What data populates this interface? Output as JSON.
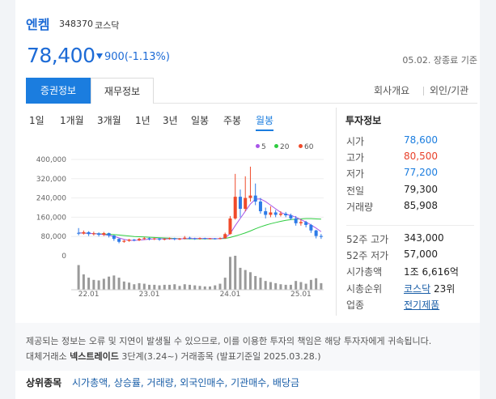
{
  "header": {
    "name": "엔켐",
    "code": "348370",
    "market": "코스닥",
    "price": "78,400",
    "change": "900(-1.13%)",
    "asof": "05.02. 장종료 기준"
  },
  "tabs": {
    "left": [
      "증권정보",
      "재무정보"
    ],
    "right": [
      "회사개요",
      "외인/기관"
    ]
  },
  "periods": [
    "1일",
    "1개월",
    "3개월",
    "1년",
    "3년",
    "일봉",
    "주봉",
    "월봉"
  ],
  "active_period": "월봉",
  "legend": [
    {
      "label": "5",
      "color": "#a855e8"
    },
    {
      "label": "20",
      "color": "#2ecc40"
    },
    {
      "label": "60",
      "color": "#f04a2a"
    }
  ],
  "chart_data": {
    "type": "candlestick",
    "y_ticks": [
      "400,000",
      "320,000",
      "240,000",
      "160,000",
      "80,000",
      "0"
    ],
    "x_ticks": [
      "22.01",
      "23.01",
      "24.01",
      "25.01"
    ],
    "ylim": [
      0,
      400000
    ],
    "candles": [
      {
        "o": 95000,
        "c": 92000,
        "h": 115000,
        "l": 85000,
        "v": 45000
      },
      {
        "o": 92000,
        "c": 98000,
        "h": 105000,
        "l": 88000,
        "v": 28000
      },
      {
        "o": 98000,
        "c": 90000,
        "h": 102000,
        "l": 82000,
        "v": 22000
      },
      {
        "o": 90000,
        "c": 93000,
        "h": 100000,
        "l": 84000,
        "v": 18000
      },
      {
        "o": 93000,
        "c": 87000,
        "h": 97000,
        "l": 80000,
        "v": 17000
      },
      {
        "o": 87000,
        "c": 94000,
        "h": 99000,
        "l": 82000,
        "v": 20000
      },
      {
        "o": 94000,
        "c": 84000,
        "h": 96000,
        "l": 76000,
        "v": 24000
      },
      {
        "o": 84000,
        "c": 70000,
        "h": 86000,
        "l": 62000,
        "v": 26000
      },
      {
        "o": 70000,
        "c": 58000,
        "h": 72000,
        "l": 52000,
        "v": 22000
      },
      {
        "o": 58000,
        "c": 62000,
        "h": 66000,
        "l": 54000,
        "v": 15000
      },
      {
        "o": 62000,
        "c": 67000,
        "h": 70000,
        "l": 58000,
        "v": 13000
      },
      {
        "o": 67000,
        "c": 64000,
        "h": 70000,
        "l": 60000,
        "v": 10000
      },
      {
        "o": 64000,
        "c": 70000,
        "h": 74000,
        "l": 61000,
        "v": 12000
      },
      {
        "o": 70000,
        "c": 73000,
        "h": 78000,
        "l": 66000,
        "v": 11000
      },
      {
        "o": 73000,
        "c": 69000,
        "h": 76000,
        "l": 64000,
        "v": 9000
      },
      {
        "o": 69000,
        "c": 72000,
        "h": 75000,
        "l": 65000,
        "v": 9000
      },
      {
        "o": 72000,
        "c": 67000,
        "h": 74000,
        "l": 62000,
        "v": 8000
      },
      {
        "o": 67000,
        "c": 70000,
        "h": 72000,
        "l": 64000,
        "v": 9000
      },
      {
        "o": 70000,
        "c": 73000,
        "h": 76000,
        "l": 67000,
        "v": 9000
      },
      {
        "o": 73000,
        "c": 69000,
        "h": 75000,
        "l": 64000,
        "v": 10000
      },
      {
        "o": 69000,
        "c": 71000,
        "h": 74000,
        "l": 65000,
        "v": 7000
      },
      {
        "o": 71000,
        "c": 75000,
        "h": 82000,
        "l": 68000,
        "v": 10000
      },
      {
        "o": 75000,
        "c": 72000,
        "h": 79000,
        "l": 68000,
        "v": 9000
      },
      {
        "o": 72000,
        "c": 70000,
        "h": 75000,
        "l": 66000,
        "v": 8000
      },
      {
        "o": 70000,
        "c": 73000,
        "h": 76000,
        "l": 67000,
        "v": 7000
      },
      {
        "o": 73000,
        "c": 71000,
        "h": 75000,
        "l": 67000,
        "v": 6000
      },
      {
        "o": 71000,
        "c": 72000,
        "h": 74000,
        "l": 68000,
        "v": 6000
      },
      {
        "o": 72000,
        "c": 70000,
        "h": 74000,
        "l": 67000,
        "v": 8000
      },
      {
        "o": 70000,
        "c": 73000,
        "h": 76000,
        "l": 68000,
        "v": 11000
      },
      {
        "o": 73000,
        "c": 90000,
        "h": 96000,
        "l": 70000,
        "v": 22000
      },
      {
        "o": 90000,
        "c": 155000,
        "h": 165000,
        "l": 88000,
        "v": 60000
      },
      {
        "o": 155000,
        "c": 245000,
        "h": 340000,
        "l": 150000,
        "v": 62000
      },
      {
        "o": 245000,
        "c": 195000,
        "h": 275000,
        "l": 160000,
        "v": 40000
      },
      {
        "o": 195000,
        "c": 240000,
        "h": 330000,
        "l": 185000,
        "v": 36000
      },
      {
        "o": 240000,
        "c": 250000,
        "h": 370000,
        "l": 225000,
        "v": 32000
      },
      {
        "o": 250000,
        "c": 225000,
        "h": 300000,
        "l": 210000,
        "v": 25000
      },
      {
        "o": 225000,
        "c": 185000,
        "h": 240000,
        "l": 175000,
        "v": 22000
      },
      {
        "o": 185000,
        "c": 170000,
        "h": 200000,
        "l": 155000,
        "v": 16000
      },
      {
        "o": 170000,
        "c": 180000,
        "h": 205000,
        "l": 160000,
        "v": 14000
      },
      {
        "o": 180000,
        "c": 170000,
        "h": 190000,
        "l": 160000,
        "v": 12000
      },
      {
        "o": 170000,
        "c": 175000,
        "h": 185000,
        "l": 163000,
        "v": 10000
      },
      {
        "o": 175000,
        "c": 168000,
        "h": 182000,
        "l": 160000,
        "v": 9000
      },
      {
        "o": 168000,
        "c": 155000,
        "h": 175000,
        "l": 148000,
        "v": 9000
      },
      {
        "o": 155000,
        "c": 135000,
        "h": 165000,
        "l": 125000,
        "v": 16000
      },
      {
        "o": 135000,
        "c": 140000,
        "h": 150000,
        "l": 125000,
        "v": 14000
      },
      {
        "o": 140000,
        "c": 128000,
        "h": 145000,
        "l": 118000,
        "v": 11000
      },
      {
        "o": 128000,
        "c": 105000,
        "h": 132000,
        "l": 95000,
        "v": 18000
      },
      {
        "o": 105000,
        "c": 82000,
        "h": 108000,
        "l": 72000,
        "v": 21000
      },
      {
        "o": 82000,
        "c": 78400,
        "h": 90000,
        "l": 70000,
        "v": 12000
      }
    ],
    "ma5": [
      95000,
      94000,
      93000,
      92000,
      90000,
      88000,
      85000,
      81000,
      74000,
      68000,
      64000,
      64000,
      65000,
      67000,
      69000,
      70000,
      70000,
      70000,
      70000,
      70000,
      70000,
      71000,
      72000,
      72000,
      72000,
      72000,
      72000,
      71000,
      71000,
      75000,
      92000,
      125000,
      155000,
      185000,
      215000,
      235000,
      236000,
      225000,
      210000,
      195000,
      180000,
      172000,
      168000,
      160000,
      150000,
      140000,
      128000,
      115000,
      100000
    ],
    "ma20": [
      95000,
      94000,
      93000,
      92000,
      91000,
      90000,
      89000,
      88000,
      86000,
      84000,
      82000,
      80000,
      79000,
      78000,
      77000,
      76000,
      75000,
      74000,
      73000,
      72000,
      71000,
      70000,
      70000,
      70000,
      70000,
      70000,
      70000,
      70000,
      71000,
      72000,
      76000,
      82000,
      88000,
      95000,
      103000,
      112000,
      120000,
      127000,
      133000,
      138000,
      143000,
      147000,
      150000,
      152000,
      153000,
      154000,
      154000,
      153000,
      152000
    ]
  },
  "info": {
    "title": "투자정보",
    "rows1": [
      {
        "label": "시가",
        "value": "78,600",
        "tone": "dn"
      },
      {
        "label": "고가",
        "value": "80,500",
        "tone": "up"
      },
      {
        "label": "저가",
        "value": "77,200",
        "tone": "dn"
      },
      {
        "label": "전일",
        "value": "79,300",
        "tone": ""
      },
      {
        "label": "거래량",
        "value": "85,908",
        "tone": ""
      }
    ],
    "rows2": [
      {
        "label": "52주 고가",
        "value": "343,000"
      },
      {
        "label": "52주 저가",
        "value": "57,000"
      },
      {
        "label": "시가총액",
        "value": "1조 6,616억"
      }
    ],
    "rank_label": "시총순위",
    "rank_market": "코스닥",
    "rank_num": "23위",
    "sector_label": "업종",
    "sector_value": "전기제품"
  },
  "notice": {
    "line1": "제공되는 정보는 오류 및 지연이 발생될 수 있으므로, 이를 이용한 투자의 책임은 해당 투자자에게 귀속됩니다.",
    "line2_pre": "대체거래소",
    "line2_bold": "넥스트레이드",
    "line2_post": "3단계(3.24~) 거래종목 (발표기준일 2025.03.28.)"
  },
  "top": {
    "label": "상위종목",
    "links": "시가총액, 상승률, 거래량, 외국인매수, 기관매수, 배당금"
  }
}
